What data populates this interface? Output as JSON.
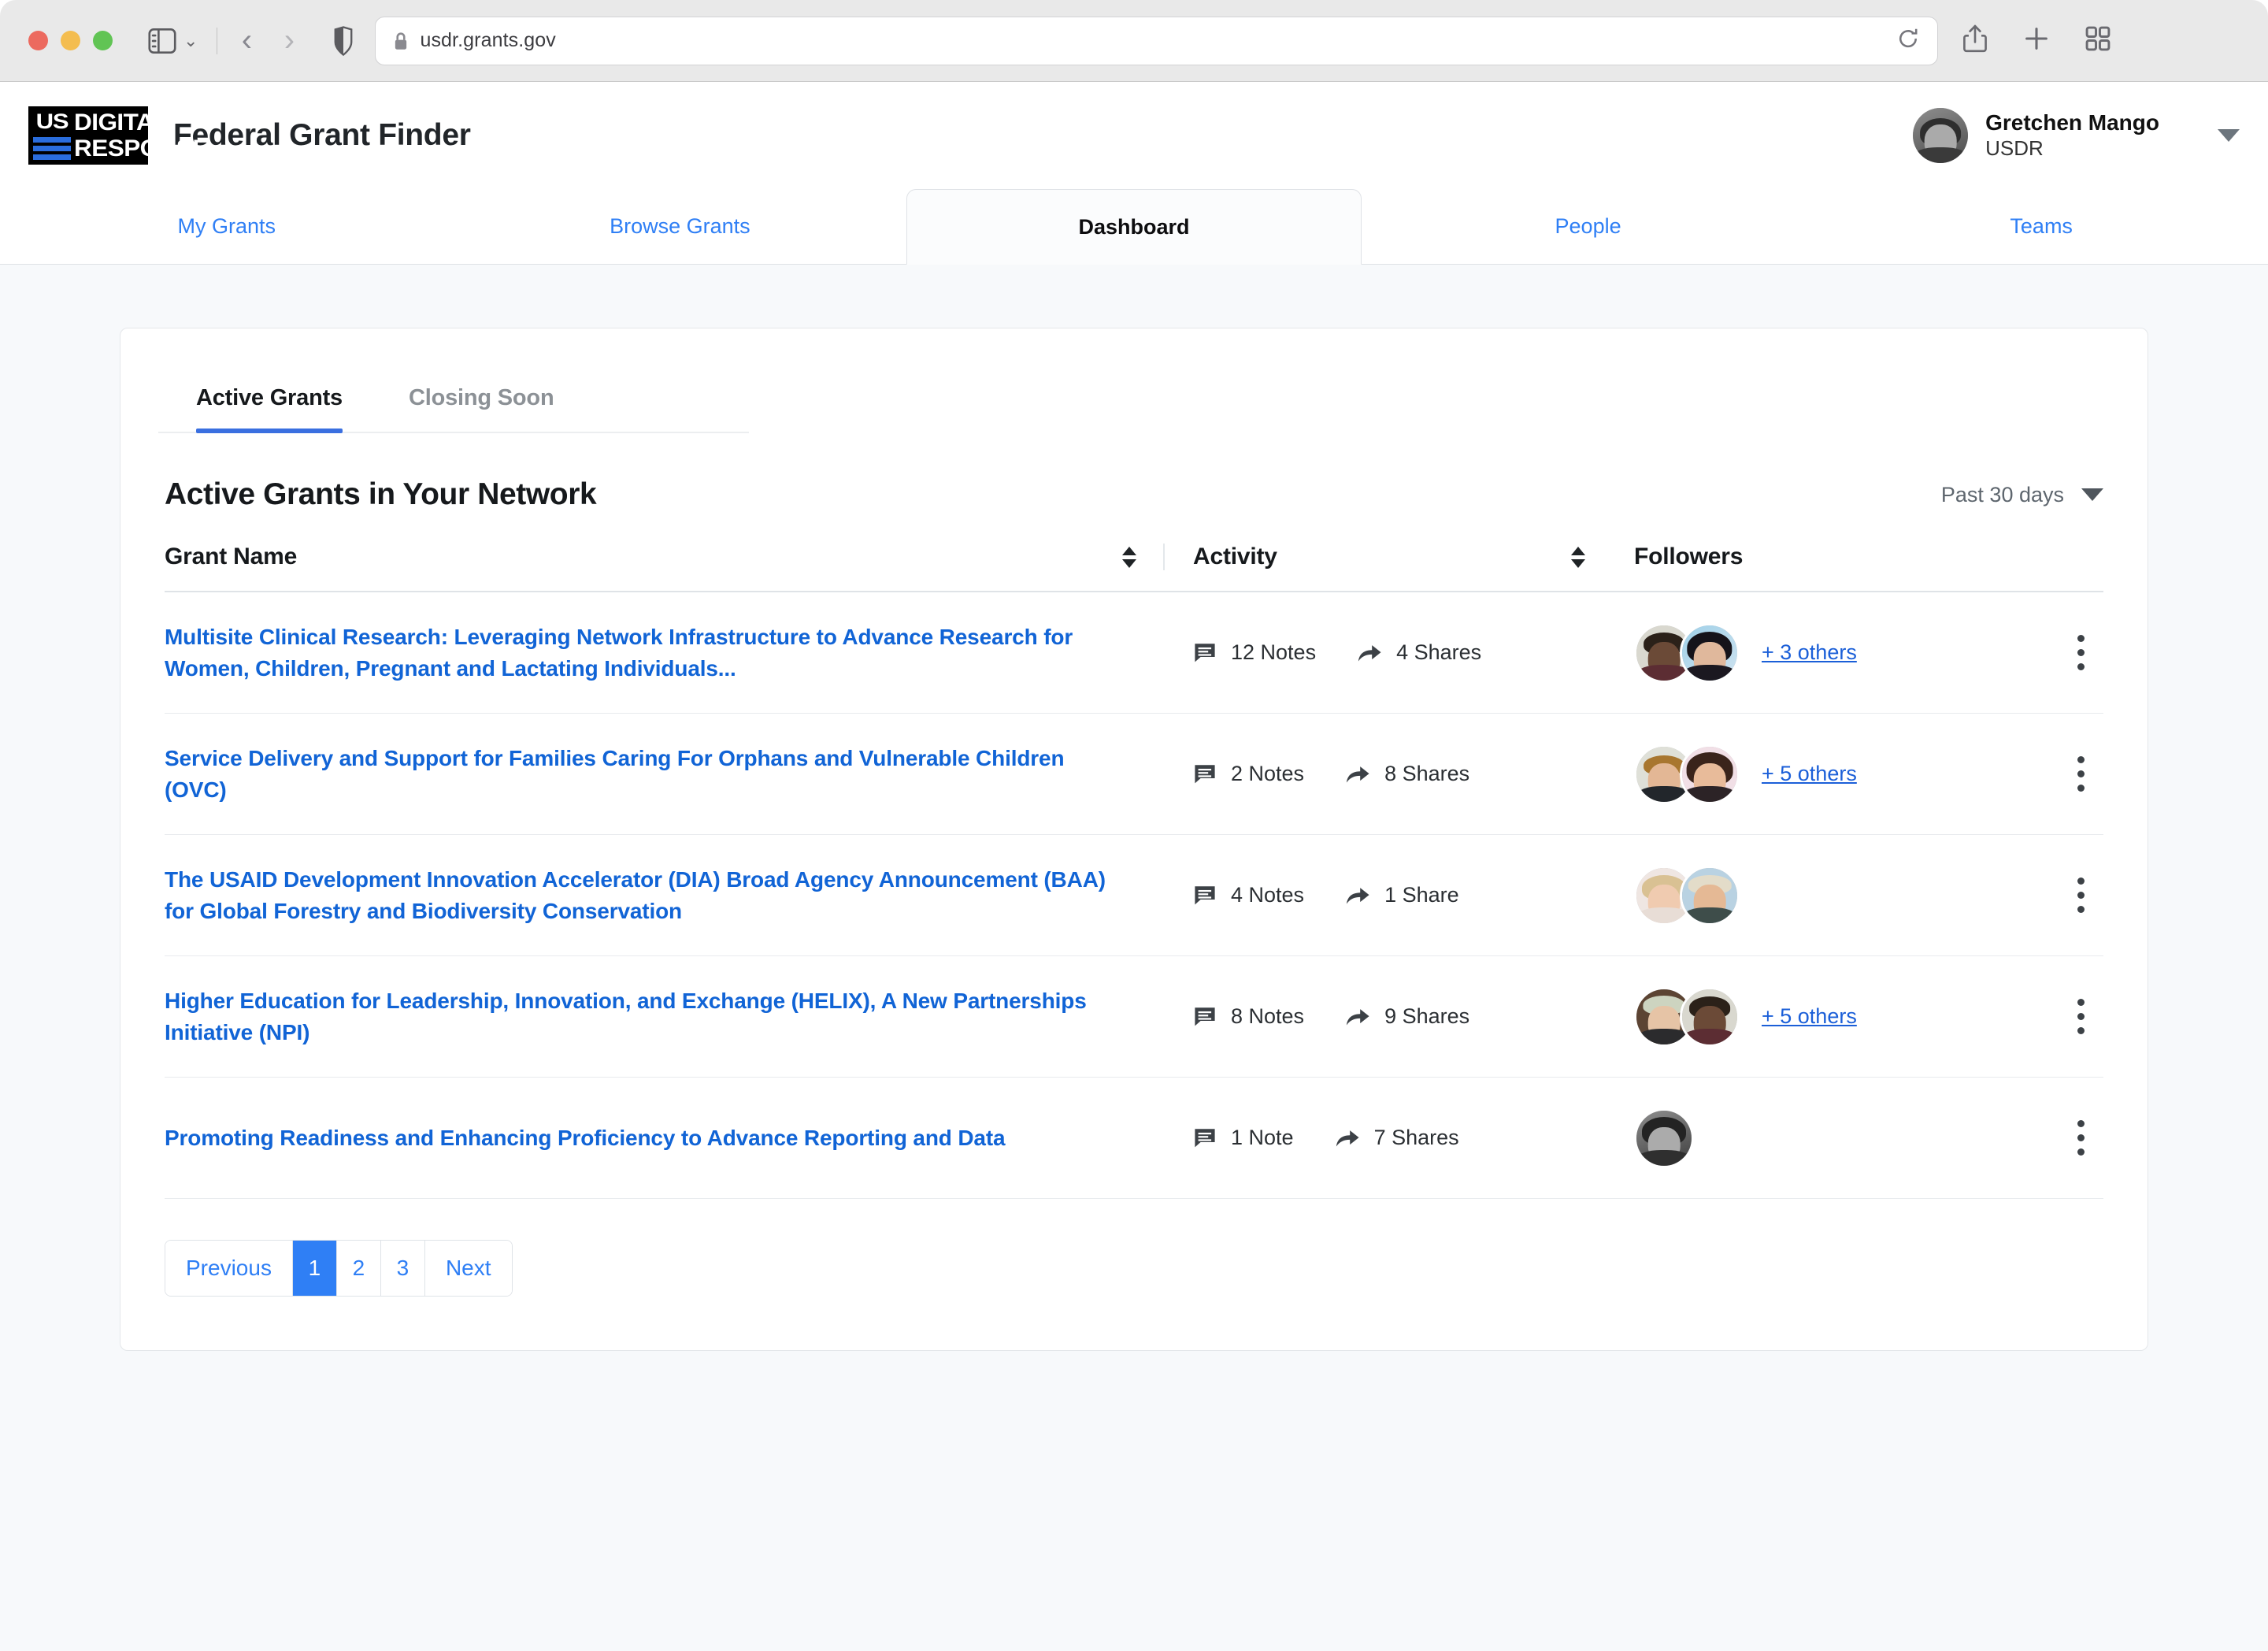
{
  "browser": {
    "url": "usdr.grants.gov",
    "lock_icon": "lock-icon",
    "reload_icon": "reload-icon",
    "sidebar_icon": "sidebar-toggle-icon",
    "back_icon": "back-arrow-icon",
    "forward_icon": "forward-arrow-icon",
    "shield_icon": "privacy-shield-icon",
    "share_icon": "share-icon",
    "newtab_icon": "plus-icon",
    "tabs_icon": "tab-overview-icon"
  },
  "header": {
    "logo_us": "US",
    "logo_line1": "DIGITAL",
    "logo_line2": "RESPONSE",
    "title": "Federal Grant Finder",
    "user": {
      "name": "Gretchen Mango",
      "org": "USDR"
    }
  },
  "main_tabs": [
    {
      "label": "My Grants",
      "active": false
    },
    {
      "label": "Browse Grants",
      "active": false
    },
    {
      "label": "Dashboard",
      "active": true
    },
    {
      "label": "People",
      "active": false
    },
    {
      "label": "Teams",
      "active": false
    }
  ],
  "card_tabs": [
    {
      "label": "Active Grants",
      "active": true
    },
    {
      "label": "Closing Soon",
      "active": false
    }
  ],
  "section": {
    "title": "Active Grants in Your Network",
    "range_label": "Past 30 days"
  },
  "table": {
    "columns": {
      "grant_name": "Grant Name",
      "activity": "Activity",
      "followers": "Followers"
    },
    "rows": [
      {
        "grant_name": "Multisite Clinical Research: Leveraging Network Infrastructure to Advance Research for Women, Children, Pregnant and Lactating Individuals...",
        "notes": "12 Notes",
        "shares": "4 Shares",
        "others": "+ 3 others",
        "avatars": 2
      },
      {
        "grant_name": "Service Delivery and Support for Families Caring For Orphans and Vulnerable Children (OVC)",
        "notes": "2 Notes",
        "shares": "8 Shares",
        "others": "+ 5 others",
        "avatars": 2
      },
      {
        "grant_name": "The USAID Development Innovation Accelerator (DIA) Broad Agency Announcement (BAA) for Global Forestry and Biodiversity Conservation",
        "notes": "4 Notes",
        "shares": "1 Share",
        "others": "",
        "avatars": 2
      },
      {
        "grant_name": "Higher Education for Leadership, Innovation, and Exchange (HELIX), A New Partnerships Initiative (NPI)",
        "notes": "8 Notes",
        "shares": "9 Shares",
        "others": "+ 5 others",
        "avatars": 2
      },
      {
        "grant_name": "Promoting Readiness and Enhancing Proficiency to Advance Reporting and Data",
        "notes": "1 Note",
        "shares": "7 Shares",
        "others": "",
        "avatars": 1
      }
    ]
  },
  "pagination": {
    "previous": "Previous",
    "pages": [
      "1",
      "2",
      "3"
    ],
    "active_page": "1",
    "next": "Next"
  },
  "colors": {
    "link_blue": "#1164d6",
    "tab_blue": "#2f7ff5",
    "accent_underline": "#3a6fe0",
    "logo_stripe": "#2a6ddd",
    "page_bg": "#f7f9fb"
  },
  "icons": {
    "notes": "notes-comment-icon",
    "shares": "share-arrow-icon",
    "sort": "sort-updown-icon",
    "kebab": "more-options-icon"
  }
}
